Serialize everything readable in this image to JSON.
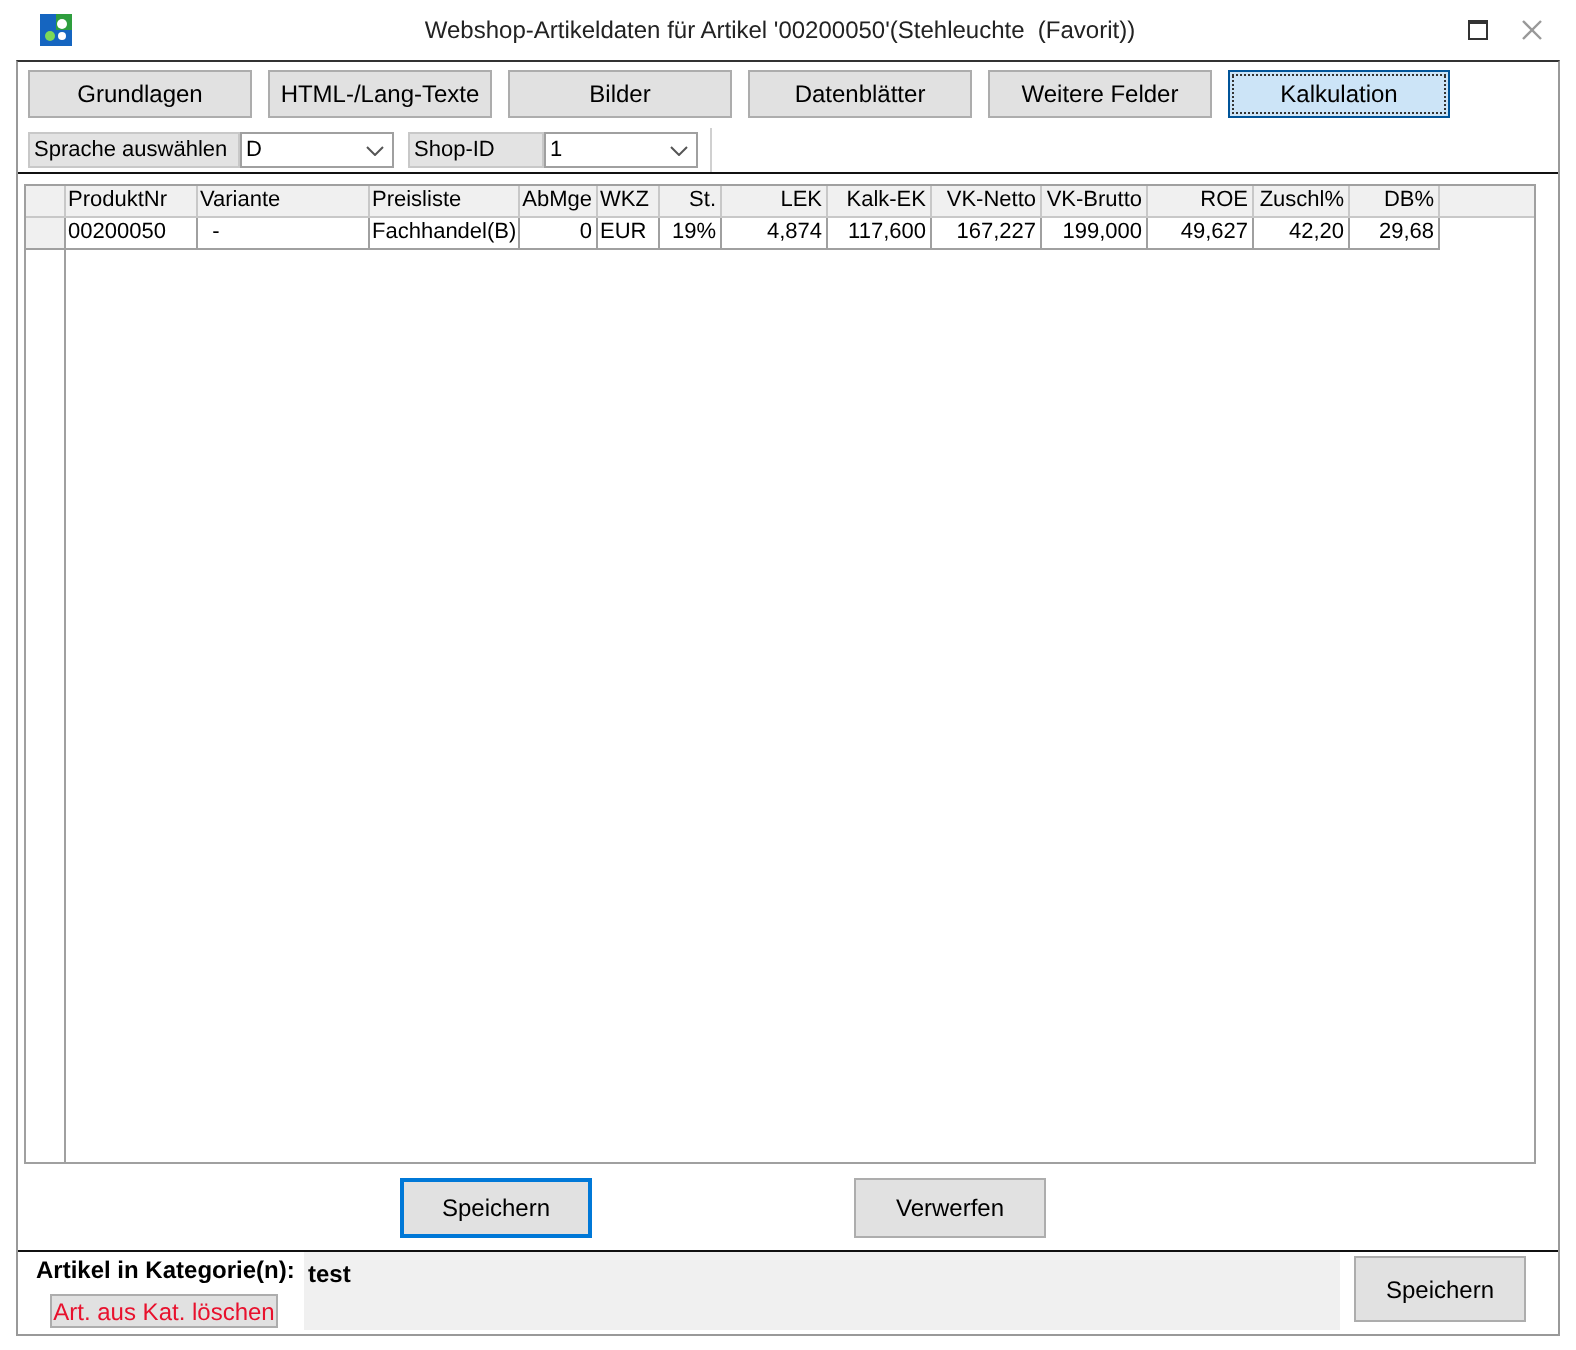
{
  "window": {
    "title": "Webshop-Artikeldaten für Artikel '00200050'(Stehleuchte  (Favorit))"
  },
  "tabs": [
    {
      "label": "Grundlagen",
      "selected": false
    },
    {
      "label": "HTML-/Lang-Texte",
      "selected": false
    },
    {
      "label": "Bilder",
      "selected": false
    },
    {
      "label": "Datenblätter",
      "selected": false
    },
    {
      "label": "Weitere Felder",
      "selected": false
    },
    {
      "label": "Kalkulation",
      "selected": true
    }
  ],
  "filters": [
    {
      "label": "Sprache auswählen",
      "value": "D"
    },
    {
      "label": "Shop-ID",
      "value": "1"
    }
  ],
  "table": {
    "columns": [
      "ProduktNr",
      "Variante",
      "Preisliste",
      "AbMge",
      "WKZ",
      "St.",
      "LEK",
      "Kalk-EK",
      "VK-Netto",
      "VK-Brutto",
      "ROE",
      "Zuschl%",
      "DB%"
    ],
    "rows": [
      {
        "cells": [
          "00200050",
          "  -",
          "Fachhandel(B)",
          "0",
          "EUR",
          "19%",
          "4,874",
          "117,600",
          "167,227",
          "199,000",
          "49,627",
          "42,20",
          "29,68"
        ]
      }
    ]
  },
  "actions": [
    {
      "label": "Speichern",
      "focused": true
    },
    {
      "label": "Verwerfen",
      "focused": false
    }
  ],
  "category_panel": {
    "label": "Artikel in Kategorie(n):",
    "value": "test",
    "remove_button": "Art. aus Kat. löschen",
    "save_button": "Speichern"
  }
}
